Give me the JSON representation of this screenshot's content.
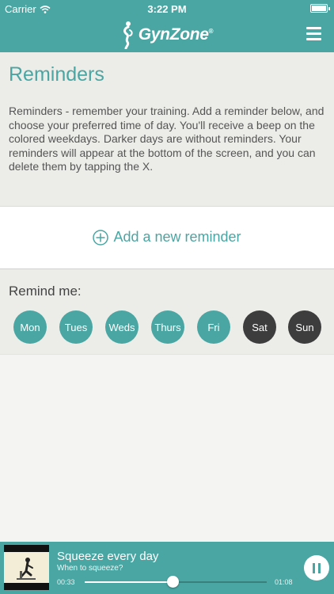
{
  "status_bar": {
    "carrier": "Carrier",
    "time": "3:22 PM"
  },
  "header": {
    "brand": "GynZone",
    "brand_mark": "®"
  },
  "intro": {
    "title": "Reminders",
    "text": "Reminders - remember your training. Add a reminder below, and choose your preferred time of day. You'll receive a beep on the colored weekdays. Darker days are without reminders. Your reminders will appear at the bottom of the screen, and you can delete them by tapping the X."
  },
  "add_reminder": {
    "label": "Add a new reminder"
  },
  "remind": {
    "label": "Remind me:",
    "days": [
      {
        "label": "Mon",
        "active": true
      },
      {
        "label": "Tues",
        "active": true
      },
      {
        "label": "Weds",
        "active": true
      },
      {
        "label": "Thurs",
        "active": true
      },
      {
        "label": "Fri",
        "active": true
      },
      {
        "label": "Sat",
        "active": false
      },
      {
        "label": "Sun",
        "active": false
      }
    ]
  },
  "player": {
    "title": "Squeeze every day",
    "subtitle": "When to squeeze?",
    "elapsed": "00:33",
    "total": "01:08",
    "progress_fraction": 0.485
  },
  "colors": {
    "accent": "#4aa6a3",
    "inactive_day": "#3d3d3d",
    "background": "#f4f4f2",
    "panel": "#ecece8"
  },
  "icons": [
    "wifi-icon",
    "battery-icon",
    "gynzone-logo-icon",
    "menu-icon",
    "plus-circle-icon",
    "pause-icon"
  ]
}
